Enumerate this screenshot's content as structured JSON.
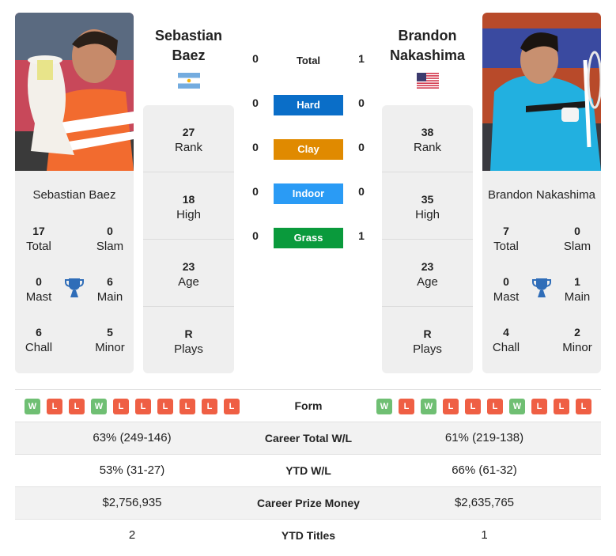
{
  "player1": {
    "name_line1": "Sebastian",
    "name_line2": "Baez",
    "full_name": "Sebastian Baez",
    "flag": "argentina-flag",
    "rank": "27",
    "rank_label": "Rank",
    "high": "18",
    "high_label": "High",
    "age": "23",
    "age_label": "Age",
    "plays": "R",
    "plays_label": "Plays",
    "titles": {
      "total": "17",
      "total_label": "Total",
      "slam": "0",
      "slam_label": "Slam",
      "mast": "0",
      "mast_label": "Mast",
      "main": "6",
      "main_label": "Main",
      "chall": "6",
      "chall_label": "Chall",
      "minor": "5",
      "minor_label": "Minor"
    },
    "form": [
      "W",
      "L",
      "L",
      "W",
      "L",
      "L",
      "L",
      "L",
      "L",
      "L"
    ]
  },
  "player2": {
    "name_line1": "Brandon",
    "name_line2": "Nakashima",
    "full_name": "Brandon Nakashima",
    "flag": "usa-flag",
    "rank": "38",
    "rank_label": "Rank",
    "high": "35",
    "high_label": "High",
    "age": "23",
    "age_label": "Age",
    "plays": "R",
    "plays_label": "Plays",
    "titles": {
      "total": "7",
      "total_label": "Total",
      "slam": "0",
      "slam_label": "Slam",
      "mast": "0",
      "mast_label": "Mast",
      "main": "1",
      "main_label": "Main",
      "chall": "4",
      "chall_label": "Chall",
      "minor": "2",
      "minor_label": "Minor"
    },
    "form": [
      "W",
      "L",
      "W",
      "L",
      "L",
      "L",
      "W",
      "L",
      "L",
      "L"
    ]
  },
  "h2h": {
    "total": {
      "label": "Total",
      "p1": "0",
      "p2": "1"
    },
    "surfaces": [
      {
        "label": "Hard",
        "p1": "0",
        "p2": "0",
        "color": "#0a6ec8"
      },
      {
        "label": "Clay",
        "p1": "0",
        "p2": "0",
        "color": "#e08a00"
      },
      {
        "label": "Indoor",
        "p1": "0",
        "p2": "0",
        "color": "#2a9bf5"
      },
      {
        "label": "Grass",
        "p1": "0",
        "p2": "1",
        "color": "#0a9a3c"
      }
    ]
  },
  "comparison": {
    "form_label": "Form",
    "rows": [
      {
        "label": "Career Total W/L",
        "p1": "63% (249-146)",
        "p2": "61% (219-138)"
      },
      {
        "label": "YTD W/L",
        "p1": "53% (31-27)",
        "p2": "66% (61-32)"
      },
      {
        "label": "Career Prize Money",
        "p1": "$2,756,935",
        "p2": "$2,635,765"
      },
      {
        "label": "YTD Titles",
        "p1": "2",
        "p2": "1"
      }
    ]
  }
}
